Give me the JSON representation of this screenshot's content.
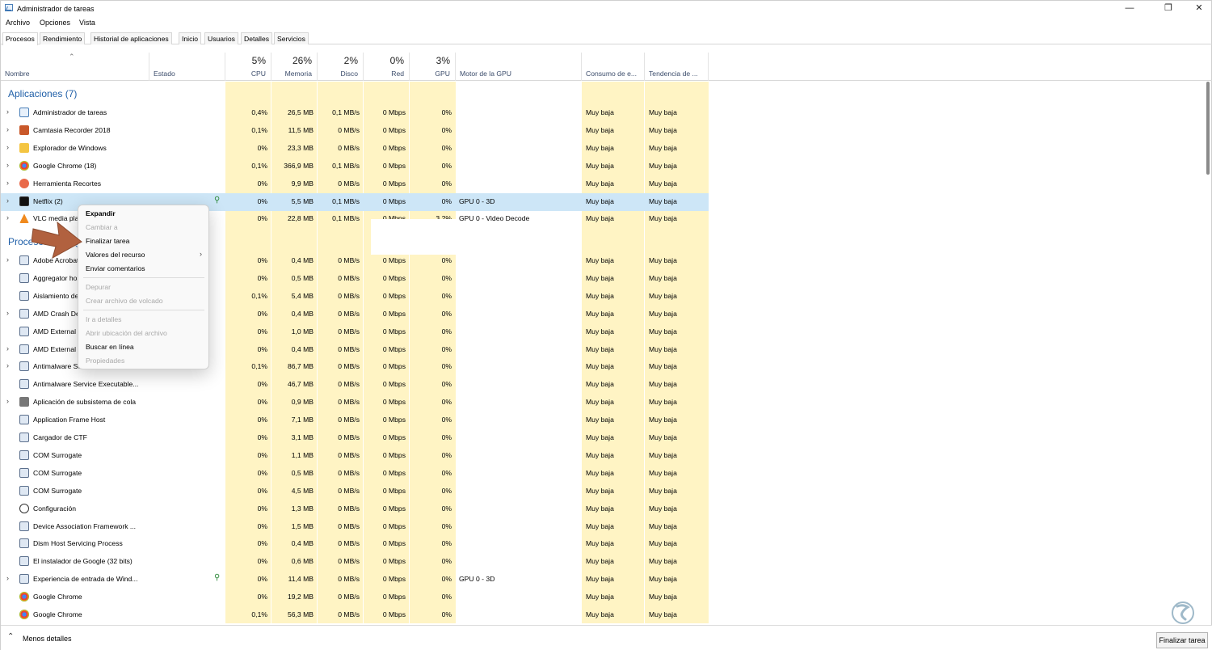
{
  "window": {
    "title": "Administrador de tareas",
    "minimize": "—",
    "restore": "❐",
    "close": "✕"
  },
  "menu": [
    "Archivo",
    "Opciones",
    "Vista"
  ],
  "tabs": [
    "Procesos",
    "Rendimiento",
    "Historial de aplicaciones",
    "Inicio",
    "Usuarios",
    "Detalles",
    "Servicios"
  ],
  "columns": {
    "name": "Nombre",
    "status": "Estado",
    "cpu": {
      "pct": "5%",
      "label": "CPU"
    },
    "mem": {
      "pct": "26%",
      "label": "Memoria"
    },
    "disk": {
      "pct": "2%",
      "label": "Disco"
    },
    "net": {
      "pct": "0%",
      "label": "Red"
    },
    "gpu": {
      "pct": "3%",
      "label": "GPU"
    },
    "gpu_engine": "Motor de la GPU",
    "power": "Consumo de e...",
    "power_trend": "Tendencia de ..."
  },
  "groups": {
    "apps": "Aplicaciones (7)",
    "background": "Procesos en segundo plano (82)"
  },
  "apps": [
    {
      "name": "Administrador de tareas",
      "cpu": "0,4%",
      "mem": "26,5 MB",
      "disk": "0,1 MB/s",
      "net": "0 Mbps",
      "gpu": "0%",
      "engine": "",
      "power": "Muy baja",
      "trend": "Muy baja"
    },
    {
      "name": "Camtasia Recorder 2018",
      "cpu": "0,1%",
      "mem": "11,5 MB",
      "disk": "0 MB/s",
      "net": "0 Mbps",
      "gpu": "0%",
      "engine": "",
      "power": "Muy baja",
      "trend": "Muy baja"
    },
    {
      "name": "Explorador de Windows",
      "cpu": "0%",
      "mem": "23,3 MB",
      "disk": "0 MB/s",
      "net": "0 Mbps",
      "gpu": "0%",
      "engine": "",
      "power": "Muy baja",
      "trend": "Muy baja"
    },
    {
      "name": "Google Chrome (18)",
      "cpu": "0,1%",
      "mem": "366,9 MB",
      "disk": "0,1 MB/s",
      "net": "0 Mbps",
      "gpu": "0%",
      "engine": "",
      "power": "Muy baja",
      "trend": "Muy baja"
    },
    {
      "name": "Herramienta Recortes",
      "cpu": "0%",
      "mem": "9,9 MB",
      "disk": "0 MB/s",
      "net": "0 Mbps",
      "gpu": "0%",
      "engine": "",
      "power": "Muy baja",
      "trend": "Muy baja"
    },
    {
      "name": "Netflix (2)",
      "cpu": "0%",
      "mem": "5,5 MB",
      "disk": "0,1 MB/s",
      "net": "0 Mbps",
      "gpu": "0%",
      "engine": "GPU 0 - 3D",
      "power": "Muy baja",
      "trend": "Muy baja"
    },
    {
      "name": "VLC media player",
      "cpu": "0%",
      "mem": "22,8 MB",
      "disk": "0,1 MB/s",
      "net": "0 Mbps",
      "gpu": "3,2%",
      "engine": "GPU 0 - Video Decode",
      "power": "Muy baja",
      "trend": "Muy baja"
    }
  ],
  "background": [
    {
      "name": "Adobe Acrobat Update Service",
      "cpu": "0%",
      "mem": "0,4 MB",
      "disk": "0 MB/s",
      "net": "0 Mbps",
      "gpu": "0%",
      "engine": "",
      "power": "Muy baja",
      "trend": "Muy baja"
    },
    {
      "name": "Aggregator host",
      "cpu": "0%",
      "mem": "0,5 MB",
      "disk": "0 MB/s",
      "net": "0 Mbps",
      "gpu": "0%",
      "engine": "",
      "power": "Muy baja",
      "trend": "Muy baja"
    },
    {
      "name": "Aislamiento de gráficos",
      "cpu": "0,1%",
      "mem": "5,4 MB",
      "disk": "0 MB/s",
      "net": "0 Mbps",
      "gpu": "0%",
      "engine": "",
      "power": "Muy baja",
      "trend": "Muy baja"
    },
    {
      "name": "AMD Crash Defender",
      "cpu": "0%",
      "mem": "0,4 MB",
      "disk": "0 MB/s",
      "net": "0 Mbps",
      "gpu": "0%",
      "engine": "",
      "power": "Muy baja",
      "trend": "Muy baja"
    },
    {
      "name": "AMD External Events",
      "cpu": "0%",
      "mem": "1,0 MB",
      "disk": "0 MB/s",
      "net": "0 Mbps",
      "gpu": "0%",
      "engine": "",
      "power": "Muy baja",
      "trend": "Muy baja"
    },
    {
      "name": "AMD External Events",
      "cpu": "0%",
      "mem": "0,4 MB",
      "disk": "0 MB/s",
      "net": "0 Mbps",
      "gpu": "0%",
      "engine": "",
      "power": "Muy baja",
      "trend": "Muy baja"
    },
    {
      "name": "Antimalware Service Executable",
      "cpu": "0,1%",
      "mem": "86,7 MB",
      "disk": "0 MB/s",
      "net": "0 Mbps",
      "gpu": "0%",
      "engine": "",
      "power": "Muy baja",
      "trend": "Muy baja"
    },
    {
      "name": "Antimalware Service Executable...",
      "cpu": "0%",
      "mem": "46,7 MB",
      "disk": "0 MB/s",
      "net": "0 Mbps",
      "gpu": "0%",
      "engine": "",
      "power": "Muy baja",
      "trend": "Muy baja"
    },
    {
      "name": "Aplicación de subsistema de cola",
      "cpu": "0%",
      "mem": "0,9 MB",
      "disk": "0 MB/s",
      "net": "0 Mbps",
      "gpu": "0%",
      "engine": "",
      "power": "Muy baja",
      "trend": "Muy baja"
    },
    {
      "name": "Application Frame Host",
      "cpu": "0%",
      "mem": "7,1 MB",
      "disk": "0 MB/s",
      "net": "0 Mbps",
      "gpu": "0%",
      "engine": "",
      "power": "Muy baja",
      "trend": "Muy baja"
    },
    {
      "name": "Cargador de CTF",
      "cpu": "0%",
      "mem": "3,1 MB",
      "disk": "0 MB/s",
      "net": "0 Mbps",
      "gpu": "0%",
      "engine": "",
      "power": "Muy baja",
      "trend": "Muy baja"
    },
    {
      "name": "COM Surrogate",
      "cpu": "0%",
      "mem": "1,1 MB",
      "disk": "0 MB/s",
      "net": "0 Mbps",
      "gpu": "0%",
      "engine": "",
      "power": "Muy baja",
      "trend": "Muy baja"
    },
    {
      "name": "COM Surrogate",
      "cpu": "0%",
      "mem": "0,5 MB",
      "disk": "0 MB/s",
      "net": "0 Mbps",
      "gpu": "0%",
      "engine": "",
      "power": "Muy baja",
      "trend": "Muy baja"
    },
    {
      "name": "COM Surrogate",
      "cpu": "0%",
      "mem": "4,5 MB",
      "disk": "0 MB/s",
      "net": "0 Mbps",
      "gpu": "0%",
      "engine": "",
      "power": "Muy baja",
      "trend": "Muy baja"
    },
    {
      "name": "Configuración",
      "cpu": "0%",
      "mem": "1,3 MB",
      "disk": "0 MB/s",
      "net": "0 Mbps",
      "gpu": "0%",
      "engine": "",
      "power": "Muy baja",
      "trend": "Muy baja"
    },
    {
      "name": "Device Association Framework ...",
      "cpu": "0%",
      "mem": "1,5 MB",
      "disk": "0 MB/s",
      "net": "0 Mbps",
      "gpu": "0%",
      "engine": "",
      "power": "Muy baja",
      "trend": "Muy baja"
    },
    {
      "name": "Dism Host Servicing Process",
      "cpu": "0%",
      "mem": "0,4 MB",
      "disk": "0 MB/s",
      "net": "0 Mbps",
      "gpu": "0%",
      "engine": "",
      "power": "Muy baja",
      "trend": "Muy baja"
    },
    {
      "name": "El instalador de Google (32 bits)",
      "cpu": "0%",
      "mem": "0,6 MB",
      "disk": "0 MB/s",
      "net": "0 Mbps",
      "gpu": "0%",
      "engine": "",
      "power": "Muy baja",
      "trend": "Muy baja"
    },
    {
      "name": "Experiencia de entrada de Wind...",
      "cpu": "0%",
      "mem": "11,4 MB",
      "disk": "0 MB/s",
      "net": "0 Mbps",
      "gpu": "0%",
      "engine": "GPU 0 - 3D",
      "power": "Muy baja",
      "trend": "Muy baja"
    },
    {
      "name": "Google Chrome",
      "cpu": "0%",
      "mem": "19,2 MB",
      "disk": "0 MB/s",
      "net": "0 Mbps",
      "gpu": "0%",
      "engine": "",
      "power": "Muy baja",
      "trend": "Muy baja"
    },
    {
      "name": "Google Chrome",
      "cpu": "0,1%",
      "mem": "56,3 MB",
      "disk": "0 MB/s",
      "net": "0 Mbps",
      "gpu": "0%",
      "engine": "",
      "power": "Muy baja",
      "trend": "Muy baja"
    }
  ],
  "context_menu": [
    {
      "label": "Expandir",
      "state": "bold"
    },
    {
      "label": "Cambiar a",
      "state": "disabled"
    },
    {
      "label": "Finalizar tarea",
      "state": "enabled"
    },
    {
      "label": "Valores del recurso",
      "state": "enabled",
      "submenu": "›"
    },
    {
      "label": "Enviar comentarios",
      "state": "enabled"
    },
    {
      "label": "Depurar",
      "state": "disabled"
    },
    {
      "label": "Crear archivo de volcado",
      "state": "disabled"
    },
    {
      "label": "Ir a detalles",
      "state": "disabled"
    },
    {
      "label": "Abrir ubicación del archivo",
      "state": "disabled"
    },
    {
      "label": "Buscar en línea",
      "state": "enabled"
    },
    {
      "label": "Propiedades",
      "state": "disabled"
    }
  ],
  "footer": {
    "less_details": "Menos detalles",
    "end_task": "Finalizar tarea"
  },
  "colors": {
    "usage_fill": "#fff4c4",
    "usage_fill_strong": "#ffe9a8",
    "selection": "#cde6f7",
    "group_title": "#1f5fa8",
    "arrow": "#b1613f"
  }
}
